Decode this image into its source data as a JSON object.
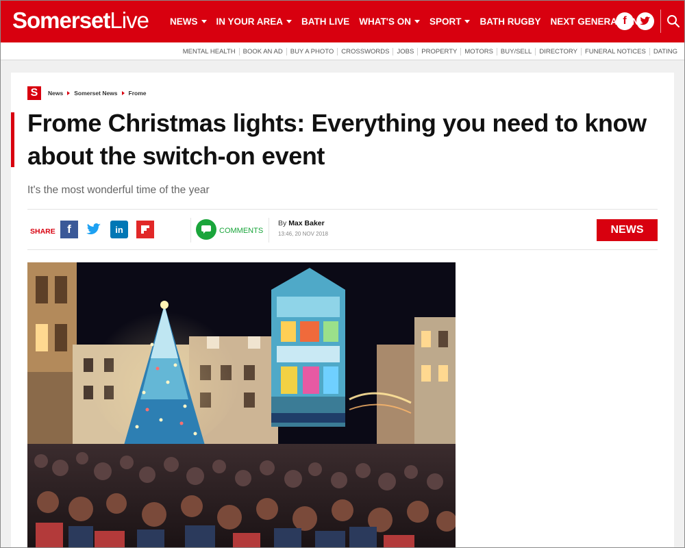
{
  "brand": {
    "logo_bold": "Somerset",
    "logo_light": "Live",
    "color": "#d8000f"
  },
  "nav": {
    "items": [
      {
        "label": "NEWS",
        "has_dropdown": true
      },
      {
        "label": "IN YOUR AREA",
        "has_dropdown": true
      },
      {
        "label": "BATH LIVE",
        "has_dropdown": false
      },
      {
        "label": "WHAT'S ON",
        "has_dropdown": true
      },
      {
        "label": "SPORT",
        "has_dropdown": true
      },
      {
        "label": "BATH RUGBY",
        "has_dropdown": false
      },
      {
        "label": "NEXT GENERATION",
        "has_dropdown": false
      }
    ],
    "social": [
      {
        "icon": "facebook-icon",
        "glyph": "f"
      },
      {
        "icon": "twitter-icon",
        "glyph": "t"
      }
    ],
    "search_icon": "search-icon"
  },
  "subnav": {
    "items": [
      "MENTAL HEALTH",
      "BOOK AN AD",
      "BUY A PHOTO",
      "CROSSWORDS",
      "JOBS",
      "PROPERTY",
      "MOTORS",
      "BUY/SELL",
      "DIRECTORY",
      "FUNERAL NOTICES",
      "DATING"
    ]
  },
  "article": {
    "badge_letter": "S",
    "breadcrumbs": [
      "News",
      "Somerset News",
      "Frome"
    ],
    "headline": "Frome Christmas lights: Everything you need to know about the switch-on event",
    "standfirst": "It's the most wonderful time of the year",
    "share_label": "SHARE",
    "share_buttons": [
      {
        "icon": "facebook-icon",
        "glyph": "f",
        "color": "#3b5998"
      },
      {
        "icon": "twitter-icon",
        "glyph": "t",
        "color": "#1da1f2"
      },
      {
        "icon": "linkedin-icon",
        "glyph": "in",
        "color": "#0077b5"
      },
      {
        "icon": "flipboard-icon",
        "glyph": "f",
        "color": "#e12828"
      }
    ],
    "comments_label": "COMMENTS",
    "byline_prefix": "By",
    "author": "Max Baker",
    "timestamp": "13:46, 20 NOV 2018",
    "category_badge": "NEWS"
  },
  "colors": {
    "accent": "#d8000f",
    "comments_green": "#1aa53b"
  }
}
